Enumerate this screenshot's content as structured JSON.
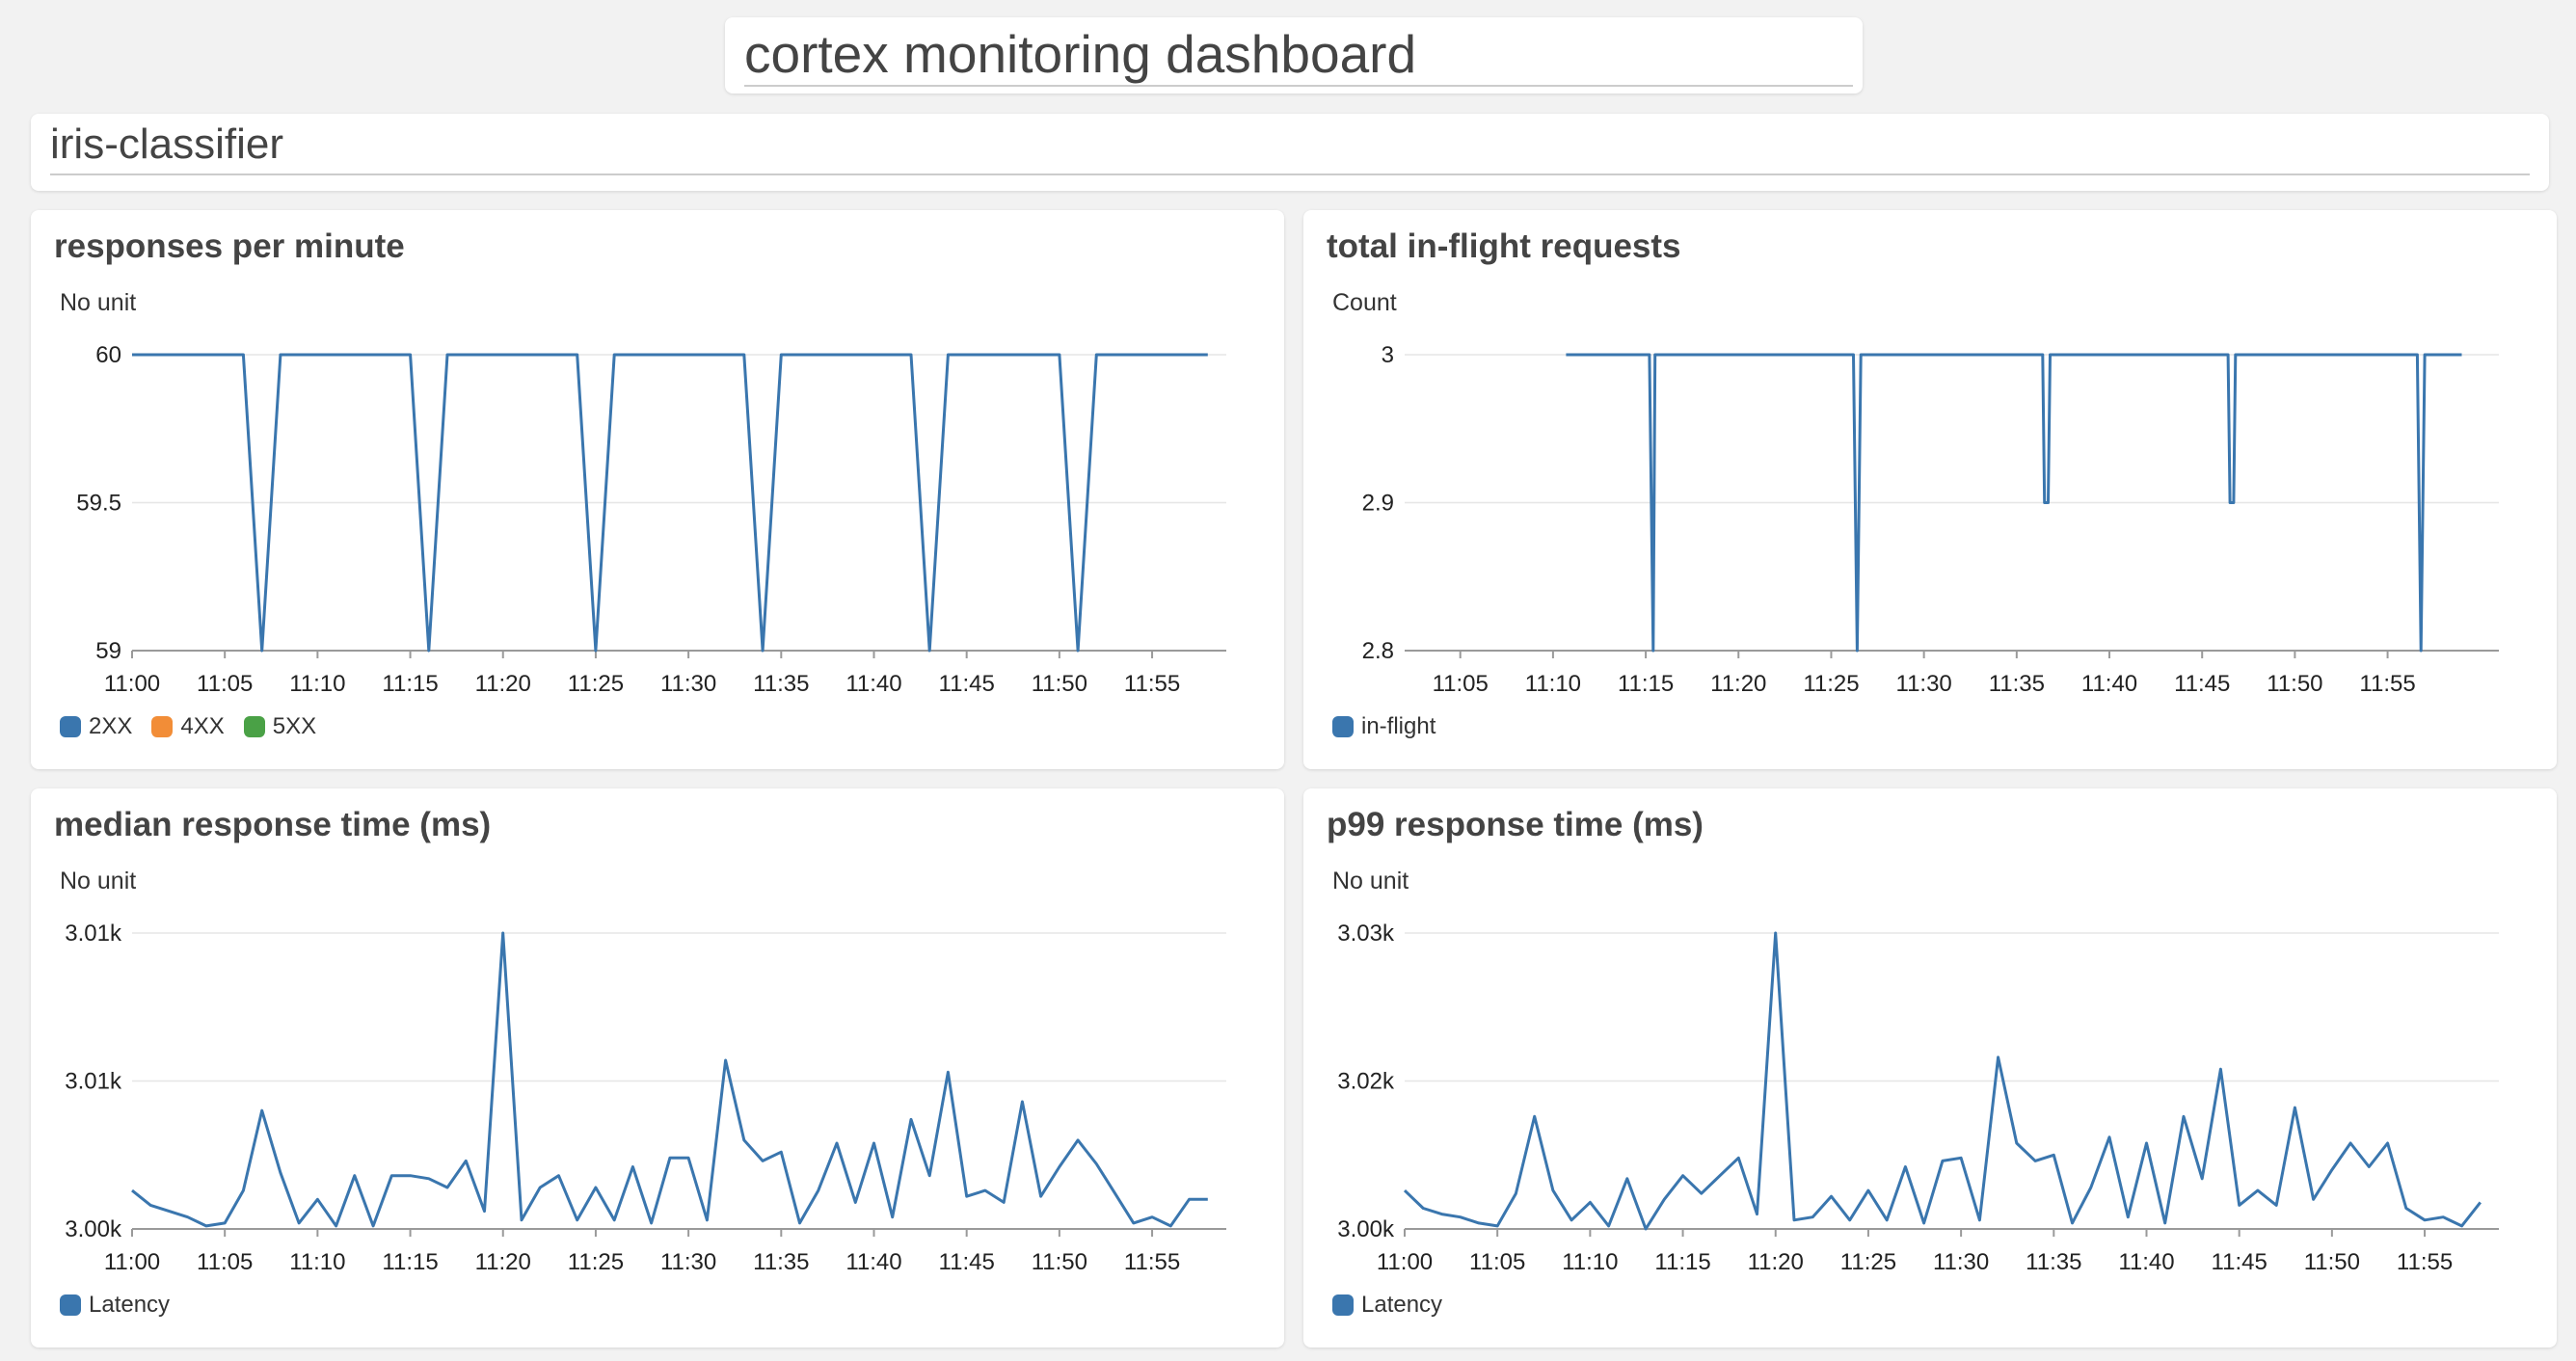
{
  "dashboard": {
    "title": "cortex monitoring dashboard"
  },
  "section": {
    "title": "iris-classifier"
  },
  "colors": {
    "blue": "#3a76ae",
    "orange": "#f28d37",
    "green": "#4aa146"
  },
  "panels": [
    {
      "title": "responses per minute",
      "unit": "No unit",
      "legend": [
        {
          "label": "2XX",
          "color": "#3a76ae"
        },
        {
          "label": "4XX",
          "color": "#f28d37"
        },
        {
          "label": "5XX",
          "color": "#4aa146"
        }
      ]
    },
    {
      "title": "total in-flight requests",
      "unit": "Count",
      "legend": [
        {
          "label": "in-flight",
          "color": "#3a76ae"
        }
      ]
    },
    {
      "title": "median response time (ms)",
      "unit": "No unit",
      "legend": [
        {
          "label": "Latency",
          "color": "#3a76ae"
        }
      ]
    },
    {
      "title": "p99 response time (ms)",
      "unit": "No unit",
      "legend": [
        {
          "label": "Latency",
          "color": "#3a76ae"
        }
      ]
    }
  ],
  "chart_data": [
    {
      "type": "line",
      "title": "responses per minute",
      "ylabel": "No unit",
      "ylim": [
        59,
        60
      ],
      "yticks": [
        59,
        59.5,
        60
      ],
      "ytick_labels": [
        "59",
        "59.5",
        "60"
      ],
      "xlim": [
        0,
        59
      ],
      "xticks": [
        0,
        5,
        10,
        15,
        20,
        25,
        30,
        35,
        40,
        45,
        50,
        55
      ],
      "xtick_labels": [
        "11:00",
        "11:05",
        "11:10",
        "11:15",
        "11:20",
        "11:25",
        "11:30",
        "11:35",
        "11:40",
        "11:45",
        "11:50",
        "11:55"
      ],
      "grid": true,
      "series": [
        {
          "name": "2XX",
          "x": [
            0,
            6,
            7,
            8,
            15,
            16,
            17,
            24,
            25,
            26,
            33,
            34,
            35,
            42,
            43,
            44,
            50,
            51,
            52,
            58
          ],
          "values": [
            60,
            60,
            59,
            60,
            60,
            59,
            60,
            60,
            59,
            60,
            60,
            59,
            60,
            60,
            59,
            60,
            60,
            59,
            60,
            60
          ]
        },
        {
          "name": "4XX",
          "x": [],
          "values": []
        },
        {
          "name": "5XX",
          "x": [],
          "values": []
        }
      ]
    },
    {
      "type": "line",
      "title": "total in-flight requests",
      "ylabel": "Count",
      "ylim": [
        2.8,
        3
      ],
      "yticks": [
        2.8,
        2.9,
        3
      ],
      "ytick_labels": [
        "2.8",
        "2.9",
        "3"
      ],
      "xlim": [
        2,
        61
      ],
      "xticks": [
        5,
        10,
        15,
        20,
        25,
        30,
        35,
        40,
        45,
        50,
        55
      ],
      "xtick_labels": [
        "11:05",
        "11:10",
        "11:15",
        "11:20",
        "11:25",
        "11:30",
        "11:35",
        "11:40",
        "11:45",
        "11:50",
        "11:55"
      ],
      "grid": true,
      "series": [
        {
          "name": "in-flight",
          "x": [
            10.7,
            15.2,
            15.4,
            15.5,
            26.2,
            26.4,
            26.6,
            36.4,
            36.5,
            36.7,
            36.8,
            46.4,
            46.5,
            46.7,
            46.8,
            56.6,
            56.8,
            57.0,
            59.0
          ],
          "values": [
            3,
            3,
            2.8,
            3,
            3,
            2.8,
            3,
            3,
            2.9,
            2.9,
            3,
            3,
            2.9,
            2.9,
            3,
            3,
            2.8,
            3,
            3
          ]
        }
      ]
    },
    {
      "type": "line",
      "title": "median response time (ms)",
      "ylabel": "No unit",
      "ylim": [
        0,
        100
      ],
      "yticks": [
        0,
        50,
        100
      ],
      "ytick_labels": [
        "3.00k",
        "3.01k",
        "3.01k"
      ],
      "xlim": [
        0,
        59
      ],
      "xticks": [
        0,
        5,
        10,
        15,
        20,
        25,
        30,
        35,
        40,
        45,
        50,
        55
      ],
      "xtick_labels": [
        "11:00",
        "11:05",
        "11:10",
        "11:15",
        "11:20",
        "11:25",
        "11:30",
        "11:35",
        "11:40",
        "11:45",
        "11:50",
        "11:55"
      ],
      "grid": true,
      "series": [
        {
          "name": "Latency",
          "x": [
            0,
            1,
            2,
            3,
            4,
            5,
            6,
            7,
            8,
            9,
            10,
            11,
            12,
            13,
            14,
            15,
            16,
            17,
            18,
            19,
            20,
            21,
            22,
            23,
            24,
            25,
            26,
            27,
            28,
            29,
            30,
            31,
            32,
            33,
            34,
            35,
            36,
            37,
            38,
            39,
            40,
            41,
            42,
            43,
            44,
            45,
            46,
            47,
            48,
            49,
            50,
            51,
            52,
            53,
            54,
            55,
            56,
            57,
            58
          ],
          "values": [
            13,
            8,
            6,
            4,
            1,
            2,
            13,
            40,
            19,
            2,
            10,
            1,
            18,
            1,
            18,
            18,
            17,
            14,
            23,
            6,
            100,
            3,
            14,
            18,
            3,
            14,
            3,
            21,
            2,
            24,
            24,
            3,
            57,
            30,
            23,
            26,
            2,
            13,
            29,
            9,
            29,
            4,
            37,
            18,
            53,
            11,
            13,
            9,
            43,
            11,
            21,
            30,
            22,
            12,
            2,
            4,
            1,
            10,
            10
          ]
        }
      ]
    },
    {
      "type": "line",
      "title": "p99 response time (ms)",
      "ylabel": "No unit",
      "ylim": [
        0,
        100
      ],
      "yticks": [
        0,
        50,
        100
      ],
      "ytick_labels": [
        "3.00k",
        "3.02k",
        "3.03k"
      ],
      "xlim": [
        0,
        59
      ],
      "xticks": [
        0,
        5,
        10,
        15,
        20,
        25,
        30,
        35,
        40,
        45,
        50,
        55
      ],
      "xtick_labels": [
        "11:00",
        "11:05",
        "11:10",
        "11:15",
        "11:20",
        "11:25",
        "11:30",
        "11:35",
        "11:40",
        "11:45",
        "11:50",
        "11:55"
      ],
      "grid": true,
      "series": [
        {
          "name": "Latency",
          "x": [
            0,
            1,
            2,
            3,
            4,
            5,
            6,
            7,
            8,
            9,
            10,
            11,
            12,
            13,
            14,
            15,
            16,
            17,
            18,
            19,
            20,
            21,
            22,
            23,
            24,
            25,
            26,
            27,
            28,
            29,
            30,
            31,
            32,
            33,
            34,
            35,
            36,
            37,
            38,
            39,
            40,
            41,
            42,
            43,
            44,
            45,
            46,
            47,
            48,
            49,
            50,
            51,
            52,
            53,
            54,
            55,
            56,
            57,
            58
          ],
          "values": [
            13,
            7,
            5,
            4,
            2,
            1,
            12,
            38,
            13,
            3,
            9,
            1,
            17,
            0,
            10,
            18,
            12,
            18,
            24,
            5,
            100,
            3,
            4,
            11,
            3,
            13,
            3,
            21,
            2,
            23,
            24,
            3,
            58,
            29,
            23,
            25,
            2,
            14,
            31,
            4,
            29,
            2,
            38,
            17,
            54,
            8,
            13,
            8,
            41,
            10,
            20,
            29,
            21,
            29,
            7,
            3,
            4,
            1,
            9
          ]
        }
      ]
    }
  ]
}
